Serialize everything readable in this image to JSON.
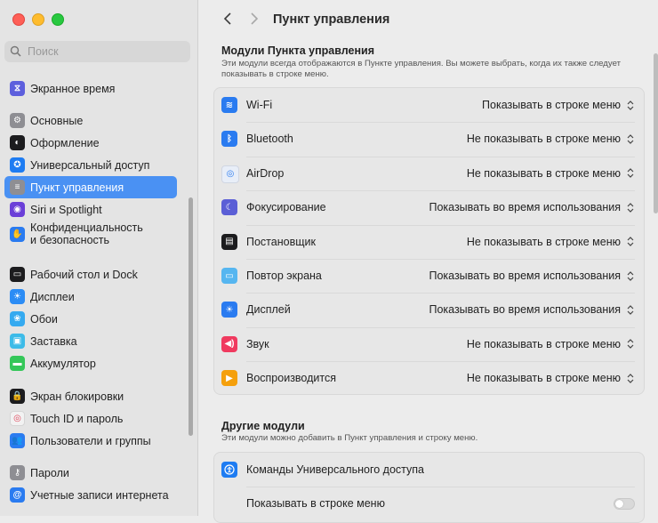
{
  "window": {
    "title": "Пункт управления"
  },
  "sidebar": {
    "search_placeholder": "Поиск",
    "items": [
      {
        "label": "Экранное время",
        "color": "#5d5fdd",
        "icon": "hourglass-icon",
        "glyph": "⧖"
      },
      {
        "label": "Основные",
        "color": "#8e8e93",
        "icon": "gear-icon",
        "glyph": "⚙"
      },
      {
        "label": "Оформление",
        "color": "#1c1c1e",
        "icon": "appearance-icon",
        "glyph": "◐"
      },
      {
        "label": "Универсальный доступ",
        "color": "#1e7cf2",
        "icon": "accessibility-icon",
        "glyph": "✪"
      },
      {
        "label": "Пункт управления",
        "color": "#8e8e93",
        "icon": "control-center-icon",
        "glyph": "≡"
      },
      {
        "label": "Siri и Spotlight",
        "color": "#6b3fd8",
        "icon": "siri-icon",
        "glyph": "◉"
      },
      {
        "label": "Конфиденциальность\nи безопасность",
        "color": "#2a7bf0",
        "icon": "privacy-hand-icon",
        "glyph": "✋"
      },
      {
        "label": "Рабочий стол и Dock",
        "color": "#1c1c1e",
        "icon": "desktop-dock-icon",
        "glyph": "▭"
      },
      {
        "label": "Дисплеи",
        "color": "#2b8cf5",
        "icon": "displays-icon",
        "glyph": "☀"
      },
      {
        "label": "Обои",
        "color": "#35aaf0",
        "icon": "wallpaper-icon",
        "glyph": "❀"
      },
      {
        "label": "Заставка",
        "color": "#3dbbe8",
        "icon": "screensaver-icon",
        "glyph": "▣"
      },
      {
        "label": "Аккумулятор",
        "color": "#34c759",
        "icon": "battery-icon",
        "glyph": "▬"
      },
      {
        "label": "Экран блокировки",
        "color": "#1c1c1e",
        "icon": "lock-icon",
        "glyph": "🔒"
      },
      {
        "label": "Touch ID и пароль",
        "color": "#f2f2f2",
        "icon": "fingerprint-icon",
        "glyph": "◎"
      },
      {
        "label": "Пользователи и группы",
        "color": "#2a7bf0",
        "icon": "users-icon",
        "glyph": "👥"
      },
      {
        "label": "Пароли",
        "color": "#8e8e93",
        "icon": "key-icon",
        "glyph": "⚷"
      },
      {
        "label": "Учетные записи интернета",
        "color": "#2a7bf0",
        "icon": "internet-accounts-icon",
        "glyph": "@"
      }
    ],
    "selected_index": 4
  },
  "main": {
    "title": "Пункт управления",
    "section1": {
      "heading": "Модули Пункта управления",
      "desc": "Эти модули всегда отображаются в Пункте управления. Вы можете выбрать, когда их также следует показывать в строке меню.",
      "rows": [
        {
          "name": "Wi-Fi",
          "value": "Показывать в строке меню",
          "color": "#2a7bf0",
          "icon": "wifi-icon",
          "glyph": "≋"
        },
        {
          "name": "Bluetooth",
          "value": "Не показывать в строке меню",
          "color": "#2a7bf0",
          "icon": "bluetooth-icon",
          "glyph": "ᛒ"
        },
        {
          "name": "AirDrop",
          "value": "Не показывать в строке меню",
          "color": "#e8eef8",
          "icon": "airdrop-icon",
          "glyph": "◎"
        },
        {
          "name": "Фокусирование",
          "value": "Показывать во время использования",
          "color": "#5b5fd6",
          "icon": "focus-moon-icon",
          "glyph": "☾"
        },
        {
          "name": "Постановщик",
          "value": "Не показывать в строке меню",
          "color": "#1c1c1e",
          "icon": "stage-manager-icon",
          "glyph": "▤"
        },
        {
          "name": "Повтор экрана",
          "value": "Показывать во время использования",
          "color": "#56b6f0",
          "icon": "screen-mirroring-icon",
          "glyph": "▭"
        },
        {
          "name": "Дисплей",
          "value": "Показывать во время использования",
          "color": "#2a7bf0",
          "icon": "display-brightness-icon",
          "glyph": "☀"
        },
        {
          "name": "Звук",
          "value": "Не показывать в строке меню",
          "color": "#f03a5f",
          "icon": "sound-icon",
          "glyph": "◀)"
        },
        {
          "name": "Воспроизводится",
          "value": "Не показывать в строке меню",
          "color": "#f5a00c",
          "icon": "now-playing-icon",
          "glyph": "▶"
        }
      ]
    },
    "section2": {
      "heading": "Другие модули",
      "desc": "Эти модули можно добавить в Пункт управления и строку меню.",
      "module_name": "Команды Универсального доступа",
      "module_color": "#1e7cf2",
      "toggle_label": "Показывать в строке меню",
      "toggle_on": false
    }
  }
}
